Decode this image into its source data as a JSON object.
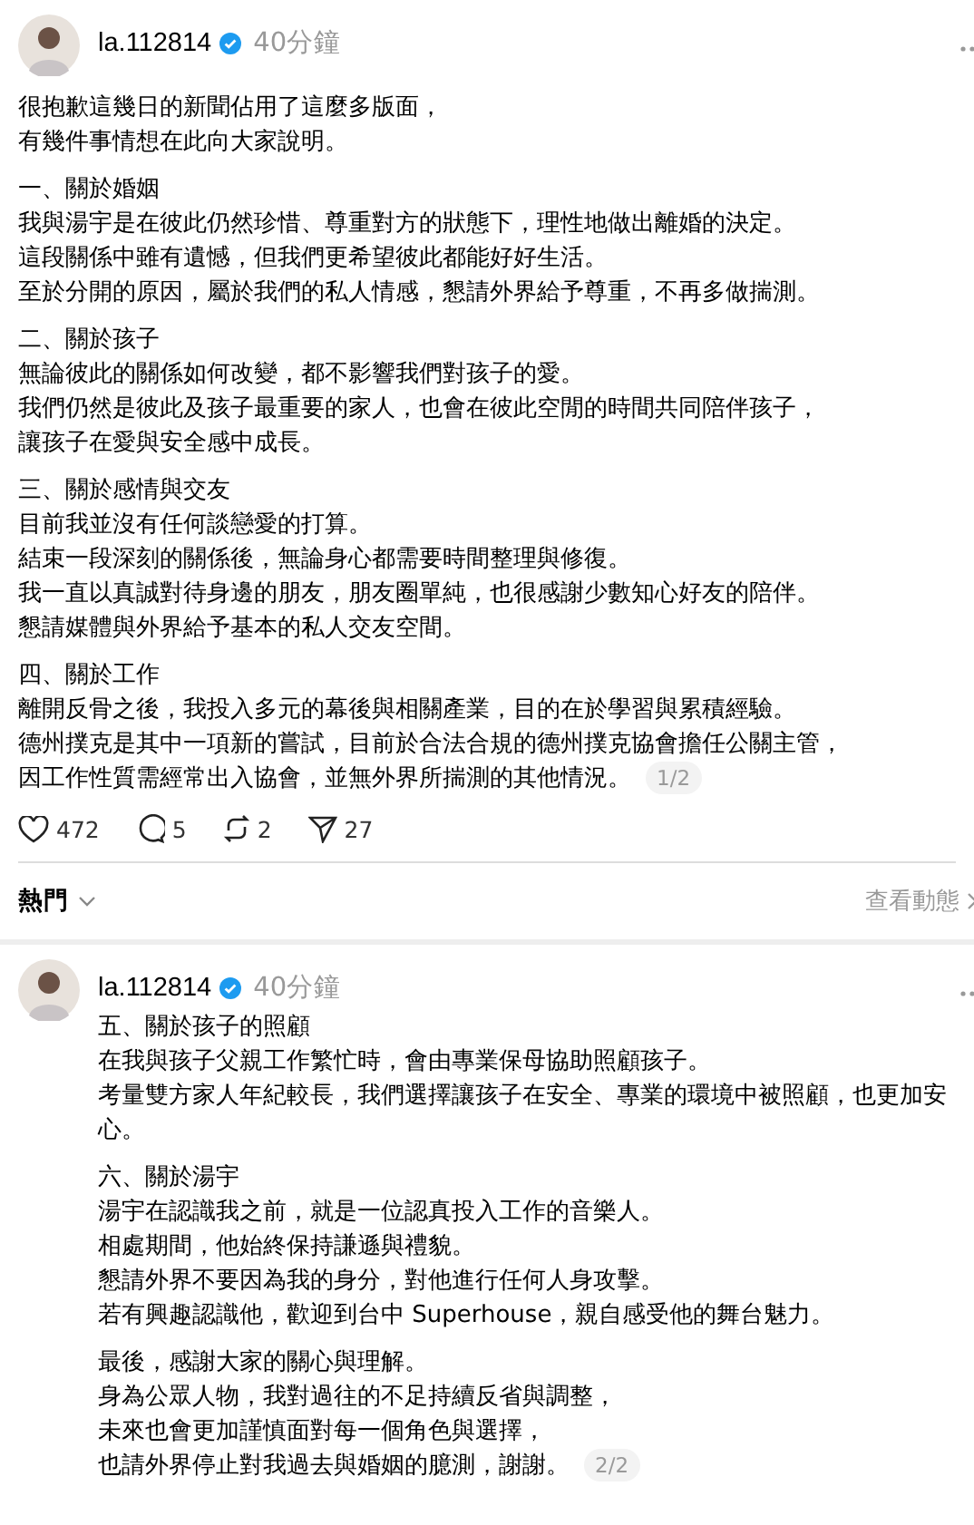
{
  "posts": [
    {
      "author": "la.112814",
      "verified": true,
      "time": "40分鐘",
      "paragraphs": [
        [
          "很抱歉這幾日的新聞佔用了這麼多版面，",
          "有幾件事情想在此向大家說明。"
        ],
        [
          "一、關於婚姻",
          "我與湯宇是在彼此仍然珍惜、尊重對方的狀態下，理性地做出離婚的決定。",
          "這段關係中雖有遺憾，但我們更希望彼此都能好好生活。",
          "至於分開的原因，屬於我們的私人情感，懇請外界給予尊重，不再多做揣測。"
        ],
        [
          "二、關於孩子",
          "無論彼此的關係如何改變，都不影響我們對孩子的愛。",
          "我們仍然是彼此及孩子最重要的家人，也會在彼此空閒的時間共同陪伴孩子，",
          "讓孩子在愛與安全感中成長。"
        ],
        [
          "三、關於感情與交友",
          "目前我並沒有任何談戀愛的打算。",
          "結束一段深刻的關係後，無論身心都需要時間整理與修復。",
          "我一直以真誠對待身邊的朋友，朋友圈單純，也很感謝少數知心好友的陪伴。",
          "懇請媒體與外界給予基本的私人交友空間。"
        ],
        [
          "四、關於工作",
          "離開反骨之後，我投入多元的幕後與相關產業，目的在於學習與累積經驗。",
          "德州撲克是其中一項新的嘗試，目前於合法合規的德州撲克協會擔任公關主管，",
          "因工作性質需經常出入協會，並無外界所揣測的其他情況。"
        ]
      ],
      "page_badge": "1/2",
      "actions": [
        {
          "kind": "like",
          "count": "472"
        },
        {
          "kind": "comment",
          "count": "5"
        },
        {
          "kind": "repost",
          "count": "2"
        },
        {
          "kind": "share",
          "count": "27"
        }
      ]
    },
    {
      "sort_label": "熱門",
      "activity_link": "查看動態"
    },
    {
      "author": "la.112814",
      "verified": true,
      "time": "40分鐘",
      "paragraphs": [
        [
          "五、關於孩子的照顧",
          "在我與孩子父親工作繁忙時，會由專業保母協助照顧孩子。",
          "考量雙方家人年紀較長，我們選擇讓孩子在安全、專業的環境中被照顧，也更加安心。"
        ],
        [
          "六、關於湯宇",
          "湯宇在認識我之前，就是一位認真投入工作的音樂人。",
          "相處期間，他始終保持謙遜與禮貌。",
          "懇請外界不要因為我的身分，對他進行任何人身攻擊。",
          "若有興趣認識他，歡迎到台中 Superhouse，親自感受他的舞台魅力。"
        ],
        [
          "最後，感謝大家的關心與理解。",
          "身為公眾人物，我對過往的不足持續反省與調整，",
          "未來也會更加謹慎面對每一個角色與選擇，",
          "也請外界停止對我過去與婚姻的臆測，謝謝。"
        ]
      ],
      "page_badge": "2/2"
    }
  ]
}
